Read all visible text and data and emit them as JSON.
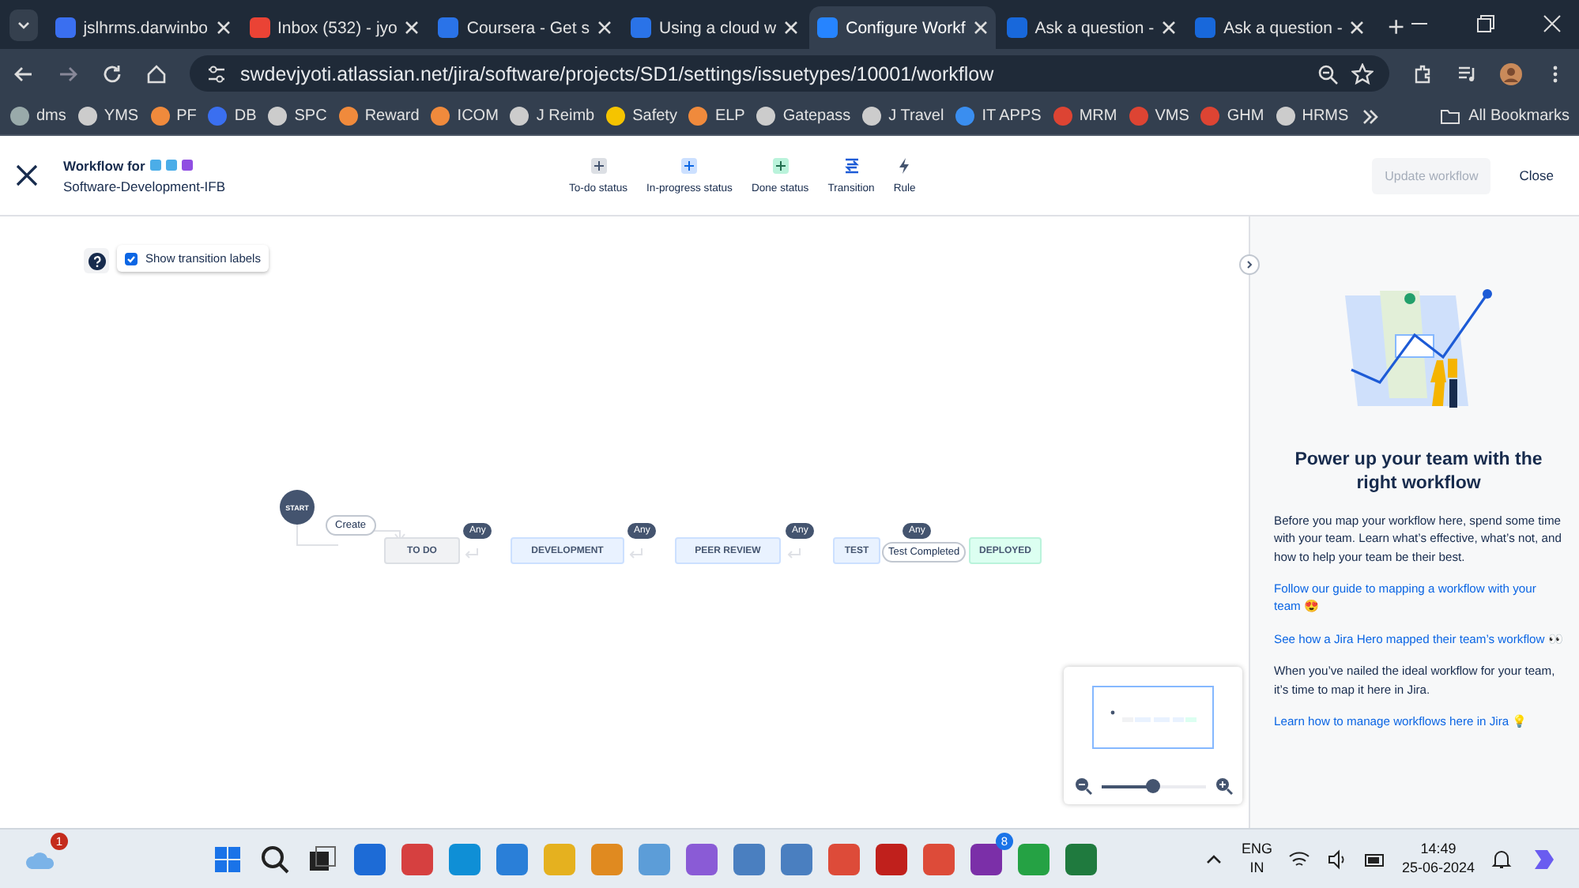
{
  "browser": {
    "tabs": [
      {
        "title": "jslhrms.darwinbo",
        "selected": false
      },
      {
        "title": "Inbox (532) - jyo",
        "selected": false
      },
      {
        "title": "Coursera - Get s",
        "selected": false
      },
      {
        "title": "Using a cloud w",
        "selected": false
      },
      {
        "title": "Configure Workf",
        "selected": true
      },
      {
        "title": "Ask a question -",
        "selected": false
      },
      {
        "title": "Ask a question -",
        "selected": false
      }
    ],
    "url": "swdevjyoti.atlassian.net/jira/software/projects/SD1/settings/issuetypes/10001/workflow",
    "bookmarks": [
      "dms",
      "YMS",
      "PF",
      "DB",
      "SPC",
      "Reward",
      "ICOM",
      "J Reimb",
      "Safety",
      "ELP",
      "Gatepass",
      "J Travel",
      "IT APPS",
      "MRM",
      "VMS",
      "GHM",
      "HRMS"
    ],
    "all_bookmarks": "All Bookmarks"
  },
  "header": {
    "title": "Workflow for",
    "subtitle": "Software-Development-IFB",
    "tools": [
      {
        "label": "To-do status",
        "kind": "todo"
      },
      {
        "label": "In-progress status",
        "kind": "inprogress"
      },
      {
        "label": "Done status",
        "kind": "done"
      },
      {
        "label": "Transition",
        "kind": "transition"
      },
      {
        "label": "Rule",
        "kind": "rule"
      }
    ],
    "update_button": {
      "label": "Update workflow",
      "disabled": true
    },
    "close_button": "Close"
  },
  "canvas": {
    "show_labels": {
      "label": "Show transition labels",
      "checked": true
    },
    "start": "START",
    "create_label": "Create",
    "statuses": [
      {
        "label": "TO DO",
        "kind": "todo",
        "any": "Any"
      },
      {
        "label": "DEVELOPMENT",
        "kind": "inprogress",
        "any": "Any"
      },
      {
        "label": "PEER REVIEW",
        "kind": "inprogress",
        "any": "Any"
      },
      {
        "label": "TEST",
        "kind": "inprogress",
        "any": "Any"
      },
      {
        "label": "DEPLOYED",
        "kind": "done"
      }
    ],
    "transition_label": "Test Completed",
    "zoom": {
      "level": 0.5
    }
  },
  "panel": {
    "heading": "Power up your team with the right workflow",
    "paragraphs": [
      {
        "kind": "text",
        "text": "Before you map your workflow here, spend some time with your team. Learn what’s effective, what’s not, and how to help your team be their best."
      },
      {
        "kind": "link",
        "text": "Follow our guide to mapping a workflow with your team 😍"
      },
      {
        "kind": "link",
        "text": "See how a Jira Hero mapped their team’s workflow 👀"
      },
      {
        "kind": "text",
        "text": "When you’ve nailed the ideal workflow for your team, it’s time to map it here in Jira."
      },
      {
        "kind": "link",
        "text": "Learn how to manage workflows here in Jira 💡"
      }
    ]
  },
  "taskbar": {
    "weather_badge": "1",
    "whatsapp_badge": "8",
    "lang": "ENG",
    "region": "IN",
    "time": "14:49",
    "date": "25-06-2024"
  }
}
